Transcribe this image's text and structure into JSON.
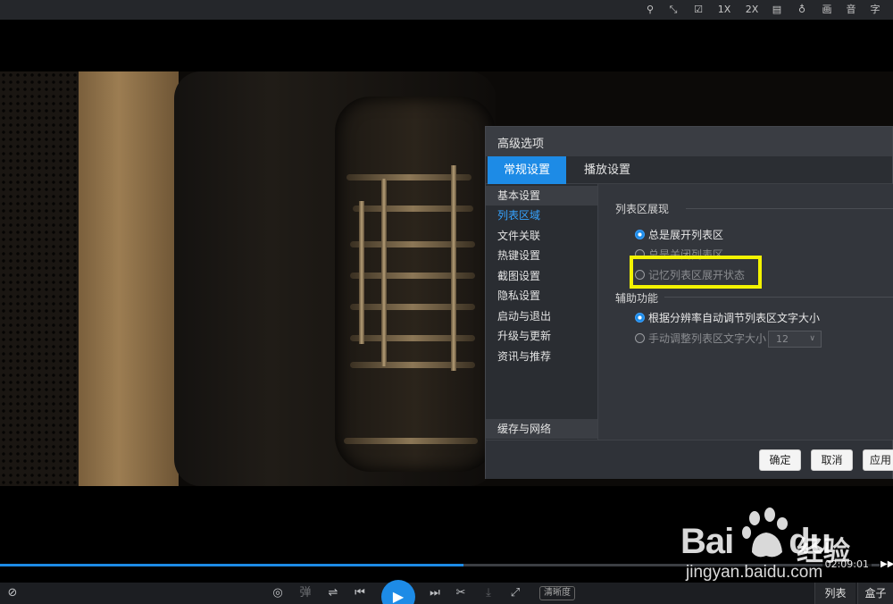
{
  "topbar": {
    "items": [
      {
        "name": "pin-icon",
        "label": "⚲"
      },
      {
        "name": "fullscreen-icon",
        "label": "⤡"
      },
      {
        "name": "check-icon",
        "label": "☑"
      },
      {
        "name": "zoom-1x-button",
        "label": "1X"
      },
      {
        "name": "zoom-2x-button",
        "label": "2X"
      },
      {
        "name": "layout-icon",
        "label": "▤"
      },
      {
        "name": "bulb-icon",
        "label": "♁"
      },
      {
        "name": "picture-button",
        "label": "画"
      },
      {
        "name": "audio-button",
        "label": "音"
      },
      {
        "name": "subtitle-button",
        "label": "字"
      }
    ]
  },
  "dialog": {
    "title": "高级选项",
    "tabs": [
      "常规设置",
      "播放设置"
    ],
    "nav": [
      {
        "label": "基本设置"
      },
      {
        "label": "列表区域"
      },
      {
        "label": "文件关联"
      },
      {
        "label": "热键设置"
      },
      {
        "label": "截图设置"
      },
      {
        "label": "隐私设置"
      },
      {
        "label": "启动与退出"
      },
      {
        "label": "升级与更新"
      },
      {
        "label": "资讯与推荐"
      },
      {
        "label": "缓存与网络"
      }
    ],
    "list_section": {
      "title": "列表区展现",
      "options": [
        "总是展开列表区",
        "总是关闭列表区",
        "记忆列表区展开状态"
      ]
    },
    "assist_section": {
      "title": "辅助功能",
      "options": [
        "根据分辨率自动调节列表区文字大小",
        "手动调整列表区文字大小"
      ],
      "font_size_value": "12"
    },
    "buttons": {
      "ok": "确定",
      "cancel": "取消",
      "apply": "应用"
    }
  },
  "player": {
    "progress_fraction": 0.527,
    "time": "02:09:01",
    "controls": {
      "danmaku_label": "弹",
      "quality_label": "清晰度",
      "list_label": "列表",
      "box_label": "盒子"
    },
    "icons": {
      "mute": "⊘",
      "eye": "◎",
      "equalizer": "⇌",
      "prev": "⏮",
      "play": "▶",
      "next": "⏭",
      "cut": "✂",
      "download": "⤓",
      "expand": "⤢",
      "forward": "▶▶"
    }
  },
  "watermark": {
    "brand": "Bai",
    "brand2": "du",
    "cn": "经验",
    "url": "jingyan.baidu.com"
  },
  "colors": {
    "accent": "#1d8be6",
    "highlight_box": "#f3f300"
  }
}
